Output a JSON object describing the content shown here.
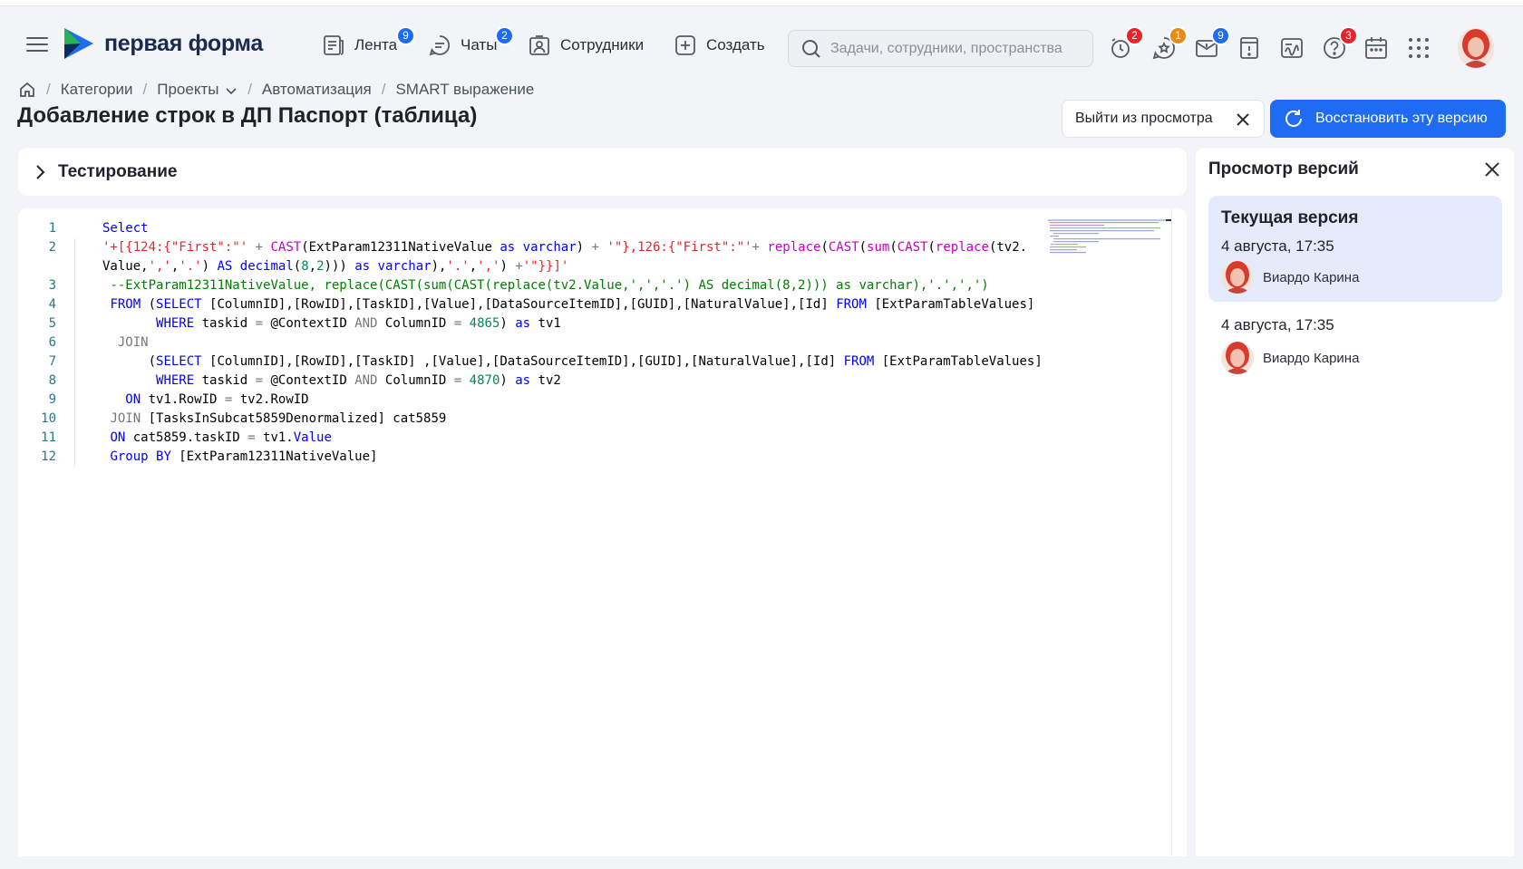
{
  "header": {
    "logo_text": "первая форма",
    "nav": [
      {
        "label": "Лента",
        "badge": "9"
      },
      {
        "label": "Чаты",
        "badge": "2"
      },
      {
        "label": "Сотрудники"
      },
      {
        "label": "Создать"
      }
    ],
    "search_placeholder": "Задачи, сотрудники, пространства",
    "tool_badges": {
      "reminders": "2",
      "favorites": "1",
      "mail": "9",
      "help": "3"
    }
  },
  "breadcrumb": [
    "Категории",
    "Проекты",
    "Автоматизация",
    "SMART выражение"
  ],
  "page_title": "Добавление строк в ДП Паспорт (таблица)",
  "actions": {
    "exit_preview": "Выйти из просмотра",
    "restore": "Восстановить эту версию"
  },
  "testing_label": "Тестирование",
  "code_line_numbers": [
    "1",
    "2",
    "3",
    "4",
    "5",
    "6",
    "7",
    "8",
    "9",
    "10",
    "11",
    "12"
  ],
  "versions": {
    "title": "Просмотр версий",
    "items": [
      {
        "name": "Текущая версия",
        "date": "4 августа, 17:35",
        "author": "Виардо Карина"
      },
      {
        "date": "4 августа, 17:35",
        "author": "Виардо Карина"
      }
    ]
  },
  "colors": {
    "accent": "#1e6cf3",
    "badge_red": "#e3262c",
    "badge_orange": "#e98a15",
    "active_version": "#e4ecfb"
  }
}
